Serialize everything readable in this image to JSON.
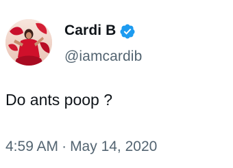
{
  "tweet": {
    "author": {
      "display_name": "Cardi B",
      "handle": "@iamcardib",
      "verified": true,
      "verified_color": "#1d9bf0"
    },
    "text": "Do ants poop ?",
    "time": "4:59 AM",
    "separator": "·",
    "date": "May 14, 2020"
  },
  "colors": {
    "text_primary": "#0f1419",
    "text_secondary": "#536471",
    "background": "#ffffff"
  },
  "icons": {
    "verified": "verified-badge-icon"
  }
}
